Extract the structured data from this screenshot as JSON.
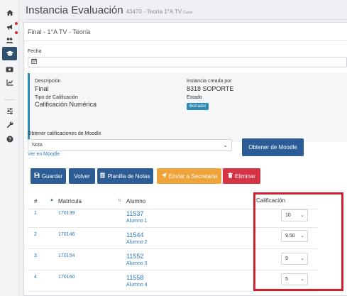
{
  "header": {
    "title": "Instancia Evaluación",
    "subtitle": "43470 - Teoría 1°A TV",
    "mini": "Curso"
  },
  "card": {
    "title": "Final - 1°A TV - Teoría"
  },
  "fecha": {
    "label": "Fecha"
  },
  "info": {
    "descripcion_label": "Descripción",
    "descripcion_value": "Final",
    "tipo_label": "Tipo de Calificación",
    "tipo_value": "Calificación Numérica",
    "creada_label": "Instancia creada por",
    "creada_value": "8318 SOPORTE",
    "estado_label": "Estado",
    "estado_badge": "Borrador"
  },
  "moodle": {
    "label": "Obtener calificaciones de Moodle",
    "selected": "Nota",
    "link": "Ver en Moodle",
    "button": "Obtener de Moodle"
  },
  "toolbar": {
    "guardar": "Guardar",
    "volver": "Volver",
    "planilla": "Planilla de Notas",
    "enviar": "Enviar a Secretaría",
    "eliminar": "Eliminar"
  },
  "table": {
    "headers": {
      "num": "#",
      "matricula": "Matrícula",
      "alumno": "Alumno",
      "calificacion": "Calificación"
    },
    "rows": [
      {
        "num": "1",
        "matricula": "170139",
        "code": "11537",
        "name": "Alumno 1",
        "grade": "10"
      },
      {
        "num": "2",
        "matricula": "170146",
        "code": "11544",
        "name": "Alumno 2",
        "grade": "9.50"
      },
      {
        "num": "3",
        "matricula": "170154",
        "code": "11552",
        "name": "Alumno 3",
        "grade": "9"
      },
      {
        "num": "4",
        "matricula": "170160",
        "code": "11558",
        "name": "Alumno 4",
        "grade": "5"
      }
    ]
  },
  "colors": {
    "primary": "#2c5d97",
    "accent": "#2c8ab5",
    "orange": "#f0a33a",
    "red": "#d63344",
    "highlight": "#d0202f"
  },
  "icons": {
    "sidebar": [
      "home-icon",
      "megaphone-icon",
      "users-icon",
      "graduation-cap-icon",
      "money-icon",
      "chart-icon",
      "sliders-icon",
      "wrench-icon",
      "help-icon"
    ]
  }
}
